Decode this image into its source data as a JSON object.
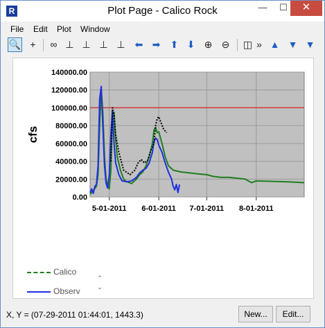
{
  "window": {
    "title": "Plot Page - Calico Rock",
    "app_icon": "R",
    "minimize": "—",
    "maximize": "☐",
    "close": "✕"
  },
  "menu": {
    "items": [
      "File",
      "Edit",
      "Plot",
      "Window"
    ]
  },
  "toolbar": {
    "icons": [
      "zoom-select-icon",
      "crosshair-icon",
      "link-icon",
      "axis-icon",
      "axis-edit-icon",
      "axis-up-icon",
      "axis-scale-icon",
      "arrow-left-icon",
      "arrow-right-icon",
      "arrow-up-icon",
      "arrow-down-icon",
      "zoom-in-icon",
      "zoom-out-icon",
      "split-view-icon",
      "overflow-chevron-icon",
      "fill-up-icon",
      "fill-down-icon",
      "marker-icon"
    ],
    "overflow": "»"
  },
  "chart_data": {
    "type": "line",
    "title": "",
    "xlabel": "",
    "ylabel": "cfs",
    "x_ticks": [
      "5-01-2011",
      "6-01-2011",
      "7-01-2011",
      "8-01-2011"
    ],
    "y_ticks": [
      "0.00",
      "20000.00",
      "40000.00",
      "60000.00",
      "80000.00",
      "100000.00",
      "120000.00",
      "140000.00"
    ],
    "xlim": [
      "2011-04-19",
      "2011-08-31"
    ],
    "ylim": [
      0,
      140000
    ],
    "grid": true,
    "background_color": "#c0c0c0",
    "threshold_line": {
      "value": 100000,
      "color": "#d43a3a"
    },
    "series": [
      {
        "name": "Calico",
        "color": "#1e7f1e",
        "style": "solid",
        "points": [
          [
            "2011-04-19",
            3000
          ],
          [
            "2011-04-21",
            7000
          ],
          [
            "2011-04-23",
            12000
          ],
          [
            "2011-04-24",
            25000
          ],
          [
            "2011-04-25",
            80000
          ],
          [
            "2011-04-26",
            120000
          ],
          [
            "2011-04-27",
            95000
          ],
          [
            "2011-04-28",
            45000
          ],
          [
            "2011-04-29",
            20000
          ],
          [
            "2011-04-30",
            12000
          ],
          [
            "2011-05-01",
            9000
          ],
          [
            "2011-05-02",
            30000
          ],
          [
            "2011-05-03",
            90000
          ],
          [
            "2011-05-04",
            95000
          ],
          [
            "2011-05-05",
            65000
          ],
          [
            "2011-05-06",
            45000
          ],
          [
            "2011-05-08",
            30000
          ],
          [
            "2011-05-10",
            20000
          ],
          [
            "2011-05-12",
            17000
          ],
          [
            "2011-05-15",
            15000
          ],
          [
            "2011-05-18",
            20000
          ],
          [
            "2011-05-20",
            25000
          ],
          [
            "2011-05-22",
            28000
          ],
          [
            "2011-05-24",
            35000
          ],
          [
            "2011-05-26",
            45000
          ],
          [
            "2011-05-28",
            60000
          ],
          [
            "2011-05-29",
            75000
          ],
          [
            "2011-05-30",
            78000
          ],
          [
            "2011-05-31",
            72000
          ],
          [
            "2011-06-01",
            73000
          ],
          [
            "2011-06-03",
            60000
          ],
          [
            "2011-06-05",
            45000
          ],
          [
            "2011-06-07",
            35000
          ],
          [
            "2011-06-10",
            30000
          ],
          [
            "2011-06-15",
            28000
          ],
          [
            "2011-06-20",
            27000
          ],
          [
            "2011-06-25",
            26000
          ],
          [
            "2011-07-01",
            25000
          ],
          [
            "2011-07-05",
            23000
          ],
          [
            "2011-07-10",
            22000
          ],
          [
            "2011-07-15",
            22000
          ],
          [
            "2011-07-20",
            21000
          ],
          [
            "2011-07-25",
            20000
          ],
          [
            "2011-07-29",
            16000
          ],
          [
            "2011-08-01",
            18000
          ],
          [
            "2011-08-10",
            17500
          ],
          [
            "2011-08-20",
            17000
          ],
          [
            "2011-08-31",
            16000
          ]
        ]
      },
      {
        "name": "Observed",
        "color": "#1f2fe0",
        "style": "solid",
        "points": [
          [
            "2011-04-19",
            5000
          ],
          [
            "2011-04-20",
            9000
          ],
          [
            "2011-04-21",
            4000
          ],
          [
            "2011-04-22",
            12000
          ],
          [
            "2011-04-23",
            14000
          ],
          [
            "2011-04-24",
            35000
          ],
          [
            "2011-04-25",
            110000
          ],
          [
            "2011-04-26",
            124000
          ],
          [
            "2011-04-27",
            80000
          ],
          [
            "2011-04-28",
            35000
          ],
          [
            "2011-04-29",
            15000
          ],
          [
            "2011-04-30",
            10000
          ],
          [
            "2011-05-01",
            25000
          ],
          [
            "2011-05-02",
            70000
          ],
          [
            "2011-05-03",
            97000
          ],
          [
            "2011-05-04",
            60000
          ],
          [
            "2011-05-05",
            38000
          ],
          [
            "2011-05-07",
            25000
          ],
          [
            "2011-05-09",
            18000
          ],
          [
            "2011-05-12",
            17000
          ],
          [
            "2011-05-15",
            18000
          ],
          [
            "2011-05-18",
            22000
          ],
          [
            "2011-05-20",
            27000
          ],
          [
            "2011-05-22",
            30000
          ],
          [
            "2011-05-24",
            32000
          ],
          [
            "2011-05-26",
            38000
          ],
          [
            "2011-05-28",
            50000
          ],
          [
            "2011-05-29",
            62000
          ],
          [
            "2011-05-30",
            66000
          ],
          [
            "2011-05-31",
            64000
          ],
          [
            "2011-06-01",
            58000
          ],
          [
            "2011-06-03",
            50000
          ],
          [
            "2011-06-05",
            38000
          ],
          [
            "2011-06-07",
            28000
          ],
          [
            "2011-06-09",
            20000
          ],
          [
            "2011-06-10",
            12000
          ],
          [
            "2011-06-11",
            8000
          ],
          [
            "2011-06-12",
            14000
          ],
          [
            "2011-06-13",
            5000
          ],
          [
            "2011-06-14",
            14000
          ]
        ]
      },
      {
        "name": "",
        "color": "#000000",
        "style": "dotted",
        "points": [
          [
            "2011-05-02",
            40000
          ],
          [
            "2011-05-03",
            100000
          ],
          [
            "2011-05-04",
            92000
          ],
          [
            "2011-05-05",
            70000
          ],
          [
            "2011-05-07",
            50000
          ],
          [
            "2011-05-10",
            30000
          ],
          [
            "2011-05-14",
            25000
          ],
          [
            "2011-05-17",
            30000
          ],
          [
            "2011-05-19",
            38000
          ],
          [
            "2011-05-21",
            42000
          ],
          [
            "2011-05-23",
            38000
          ],
          [
            "2011-05-25",
            41000
          ],
          [
            "2011-05-27",
            52000
          ],
          [
            "2011-05-29",
            60000
          ],
          [
            "2011-05-30",
            80000
          ],
          [
            "2011-05-31",
            88000
          ],
          [
            "2011-06-01",
            90000
          ],
          [
            "2011-06-02",
            85000
          ],
          [
            "2011-06-04",
            76000
          ],
          [
            "2011-06-06",
            72000
          ]
        ]
      }
    ]
  },
  "legend": {
    "items": [
      {
        "label": "Calico",
        "color": "#1e7f1e",
        "dash": "6,4"
      },
      {
        "label": "Observ",
        "color": "#1f2fe0",
        "dash": ""
      }
    ]
  },
  "status": {
    "coords_text": "X, Y = (07-29-2011 01:44:01, 1443.3)"
  },
  "buttons": {
    "new_label": "New...",
    "edit_label": "Edit..."
  }
}
